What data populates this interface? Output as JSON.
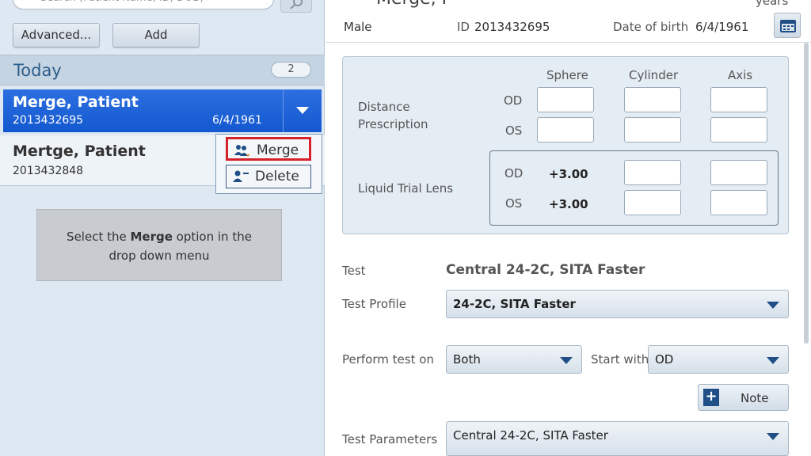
{
  "sidebar": {
    "search_placeholder": "Search (Patient Name, ID, DOB)",
    "advanced_label": "Advanced...",
    "add_label": "Add",
    "group_label": "Today",
    "group_count": "2",
    "patients": [
      {
        "name": "Merge, Patient",
        "id": "2013432695",
        "dob": "6/4/1961"
      },
      {
        "name": "Mertge, Patient",
        "id": "2013432848",
        "dob": ""
      }
    ],
    "menu": {
      "merge": "Merge",
      "delete": "Delete"
    },
    "tooltip": {
      "before": "Select the ",
      "bold": "Merge",
      "after": " option in the drop down menu"
    }
  },
  "header": {
    "name_partial": "Merge, P",
    "age_partial": "years",
    "sex": "Male",
    "id_label": "ID",
    "id_value": "2013432695",
    "dob_label": "Date of birth",
    "dob_value": "6/4/1961"
  },
  "prescription": {
    "col_sphere": "Sphere",
    "col_cylinder": "Cylinder",
    "col_axis": "Axis",
    "distance_label": "Distance Prescription",
    "od": "OD",
    "os": "OS",
    "liquid_label": "Liquid Trial Lens",
    "liquid_od_value": "+3.00",
    "liquid_os_value": "+3.00"
  },
  "form": {
    "test_label": "Test",
    "test_value": "Central 24-2C, SITA Faster",
    "profile_label": "Test Profile",
    "profile_value": "24-2C, SITA Faster",
    "perform_label": "Perform test on",
    "perform_value": "Both",
    "start_label": "Start with",
    "start_value": "OD",
    "note_label": "Note",
    "params_label": "Test Parameters",
    "params_value": "Central 24-2C, SITA Faster"
  }
}
